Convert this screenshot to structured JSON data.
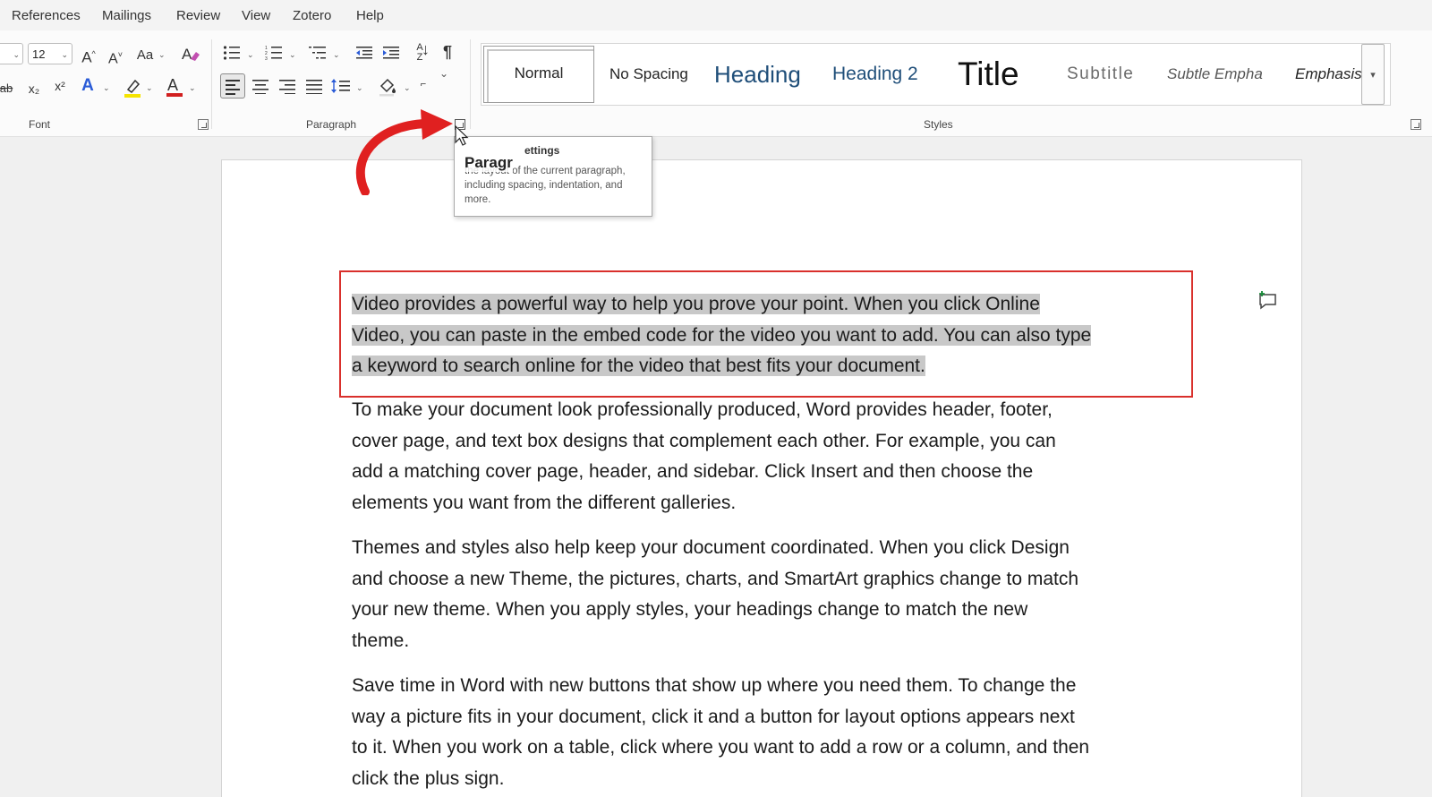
{
  "menu": [
    "References",
    "Mailings",
    "Review",
    "View",
    "Zotero",
    "Help"
  ],
  "font_group": {
    "size_value": "12",
    "grow_label": "A^",
    "shrink_label": "A˅",
    "case_label": "Aa",
    "subscript_label": "x₂",
    "superscript_label": "x²",
    "label": "Font"
  },
  "paragraph_group": {
    "label": "Paragraph",
    "pilcrow": "¶",
    "sort_label": "A↓Z"
  },
  "styles_group": {
    "label": "Styles",
    "items": [
      "Normal",
      "No Spacing",
      "Heading",
      "Heading 2",
      "Title",
      "Subtitle",
      "Subtle Empha",
      "Emphasis"
    ],
    "colors": {
      "heading": "#1f4e79",
      "title": "#111111",
      "subtitle": "#6b6b6b"
    }
  },
  "tooltip": {
    "title_ghost": "Paragr",
    "title": "Paragraph Settings",
    "title_visible": "ettings",
    "body": "the layout of the current paragraph, including spacing, indentation, and more."
  },
  "document": {
    "paragraphs": [
      {
        "lines": [
          "Video provides a powerful way to help you prove your point. When you click Online",
          "Video, you can paste in the embed code for the video you want to add. You can also type",
          "a keyword to search online for the video that best fits your document."
        ]
      },
      {
        "lines": [
          "To make your document look professionally produced, Word provides header, footer,",
          "cover page, and text box designs that complement each other. For example, you can",
          "add a matching cover page, header, and sidebar. Click Insert and then choose the",
          "elements you want from the different galleries."
        ]
      },
      {
        "lines": [
          "Themes and styles also help keep your document coordinated. When you click Design",
          "and choose a new Theme, the pictures, charts, and SmartArt graphics change to match",
          "your new theme. When you apply styles, your headings change to match the new",
          "theme."
        ]
      },
      {
        "lines": [
          "Save time in Word with new buttons that show up where you need them. To change the",
          "way a picture fits in your document, click it and a button for layout options appears next",
          "to it. When you work on a table, click where you want to add a row or a column, and then",
          "click the plus sign."
        ]
      }
    ]
  },
  "colors": {
    "selection_border": "#d9302c",
    "arrow": "#e02020",
    "selection_fill": "#c8c8c8"
  }
}
